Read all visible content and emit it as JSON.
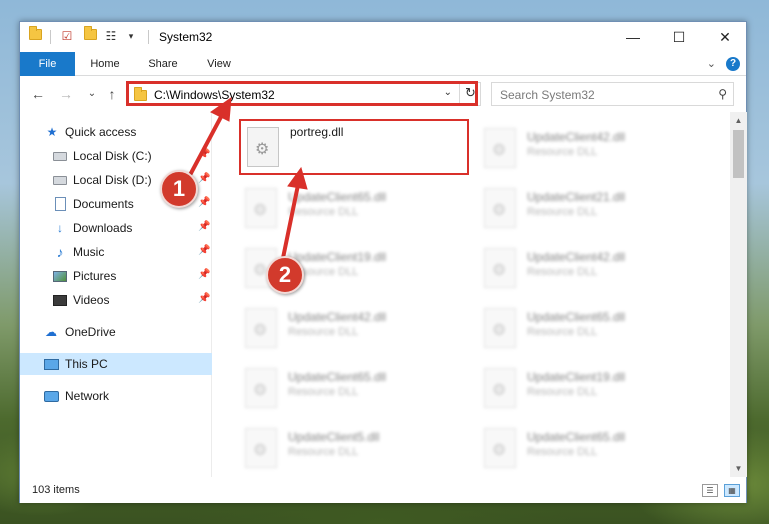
{
  "window": {
    "title": "System32",
    "minimize_glyph": "—",
    "maximize_glyph": "☐",
    "close_glyph": "✕"
  },
  "ribbon": {
    "tabs": [
      {
        "label": "File",
        "active": true
      },
      {
        "label": "Home"
      },
      {
        "label": "Share"
      },
      {
        "label": "View"
      }
    ],
    "expand_glyph": "⌄",
    "help_glyph": "?"
  },
  "navigation": {
    "back_glyph": "←",
    "forward_glyph": "→",
    "recent_glyph": "⌄",
    "up_glyph": "↑",
    "address": "C:\\Windows\\System32",
    "address_dropdown_glyph": "⌄",
    "refresh_glyph": "↻",
    "search_placeholder": "Search System32",
    "search_glyph": "⚲"
  },
  "sidebar": {
    "items": [
      {
        "label": "Quick access",
        "icon": "star-icon",
        "pinned": false
      },
      {
        "label": "Local Disk (C:)",
        "icon": "drive-icon",
        "pinned": true
      },
      {
        "label": "Local Disk (D:)",
        "icon": "drive-icon",
        "pinned": true
      },
      {
        "label": "Documents",
        "icon": "documents-icon",
        "pinned": true
      },
      {
        "label": "Downloads",
        "icon": "downloads-icon",
        "pinned": true
      },
      {
        "label": "Music",
        "icon": "music-icon",
        "pinned": true
      },
      {
        "label": "Pictures",
        "icon": "pictures-icon",
        "pinned": true
      },
      {
        "label": "Videos",
        "icon": "videos-icon",
        "pinned": true
      },
      {
        "label": "OneDrive",
        "icon": "onedrive-icon",
        "pinned": false
      },
      {
        "label": "This PC",
        "icon": "this-pc-icon",
        "pinned": false,
        "selected": true
      },
      {
        "label": "Network",
        "icon": "network-icon",
        "pinned": false
      }
    ],
    "pin_glyph": "📌",
    "star_glyph": "★",
    "music_glyph": "♪",
    "cloud_glyph": "☁",
    "download_glyph": "↓"
  },
  "files": {
    "left_column": [
      {
        "name": "portreg.dll",
        "type": "",
        "highlighted": true
      },
      {
        "name": "UpdateClient65.dll",
        "type": "Resource DLL"
      },
      {
        "name": "UpdateClient19.dll",
        "type": "Resource DLL"
      },
      {
        "name": "UpdateClient42.dll",
        "type": "Resource DLL"
      },
      {
        "name": "UpdateClient65.dll",
        "type": "Resource DLL"
      },
      {
        "name": "UpdateClient5.dll",
        "type": "Resource DLL"
      }
    ],
    "right_column": [
      {
        "name": "UpdateClient42.dll",
        "type": "Resource DLL"
      },
      {
        "name": "UpdateClient21.dll",
        "type": "Resource DLL"
      },
      {
        "name": "UpdateClient42.dll",
        "type": "Resource DLL"
      },
      {
        "name": "UpdateClient65.dll",
        "type": "Resource DLL"
      },
      {
        "name": "UpdateClient19.dll",
        "type": "Resource DLL"
      },
      {
        "name": "UpdateClient65.dll",
        "type": "Resource DLL"
      }
    ]
  },
  "scrollbar": {
    "up_glyph": "▲",
    "down_glyph": "▼"
  },
  "status": {
    "item_count": "103 items",
    "details_view_glyph": "☰",
    "tiles_view_glyph": "▦"
  },
  "annotations": {
    "step1": "1",
    "step2": "2",
    "color": "#d9302a"
  }
}
